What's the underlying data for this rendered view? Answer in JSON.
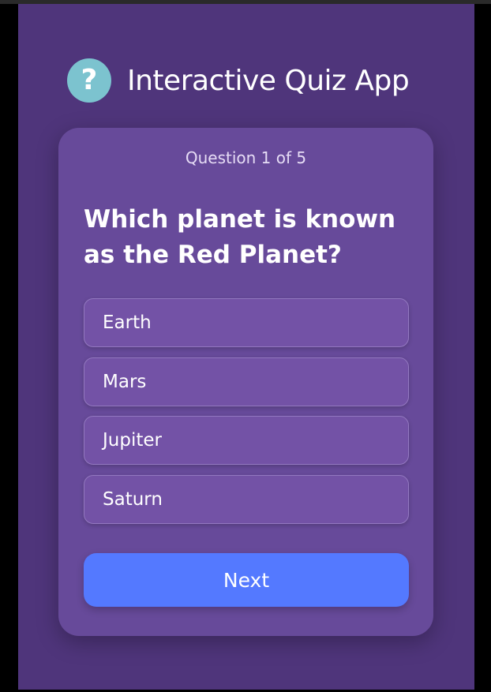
{
  "app": {
    "title": "Interactive Quiz App",
    "logo_glyph": "?",
    "logo_icon": "question-mark-icon",
    "background_color": "#4f357b",
    "logo_color": "#7cc3cf"
  },
  "quiz": {
    "progress_label": "Question 1 of 5",
    "question": "Which planet is known as the Red Planet?",
    "options": [
      {
        "label": "Earth"
      },
      {
        "label": "Mars"
      },
      {
        "label": "Jupiter"
      },
      {
        "label": "Saturn"
      }
    ],
    "next_label": "Next",
    "card_color": "#674a9a",
    "option_color": "#7352a6",
    "button_color": "#5479ff"
  }
}
